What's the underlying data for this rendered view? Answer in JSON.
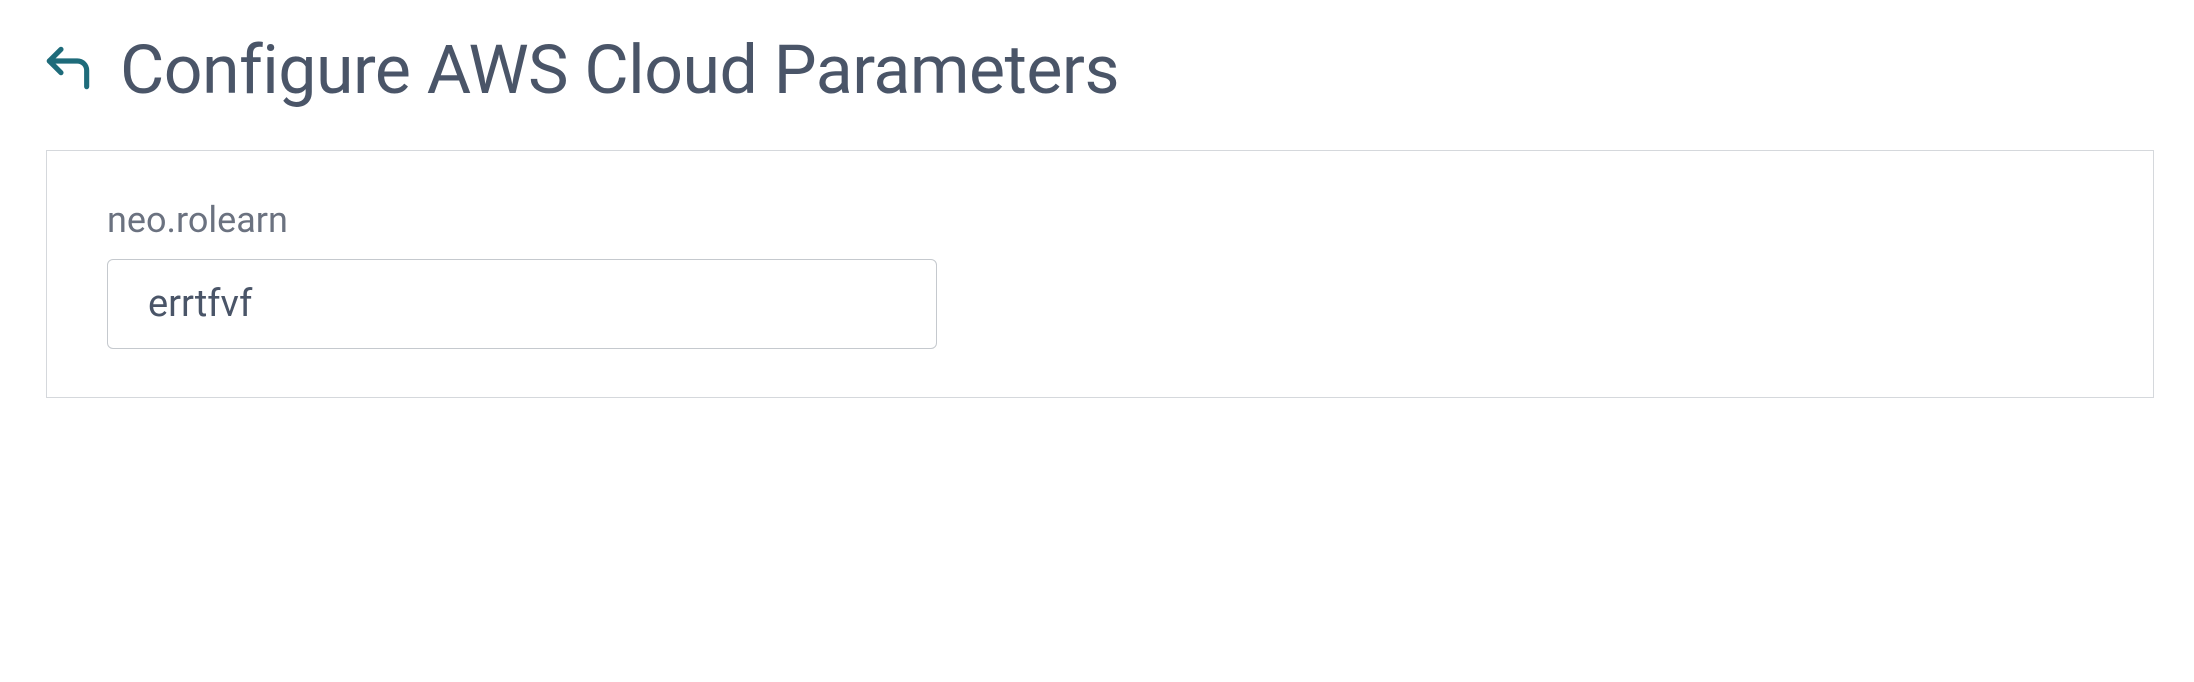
{
  "header": {
    "title": "Configure AWS Cloud Parameters"
  },
  "form": {
    "fields": {
      "rolearn": {
        "label": "neo.rolearn",
        "value": "errtfvf"
      }
    }
  }
}
